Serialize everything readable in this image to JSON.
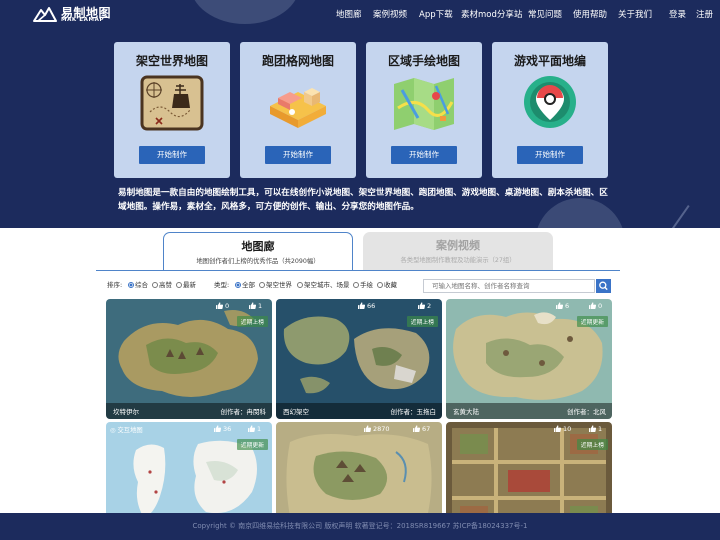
{
  "brand": {
    "name_cn": "易制地图",
    "name_en": "MAK EAMAP"
  },
  "nav": {
    "items": [
      "地图廊",
      "案例视频",
      "App下载",
      "素材mod分享站",
      "常见问题",
      "使用帮助",
      "关于我们"
    ],
    "login": "登录",
    "register": "注册"
  },
  "cards": [
    {
      "title": "架空世界地图",
      "button": "开始制作",
      "icon": "treasure-map-icon"
    },
    {
      "title": "跑团格网地图",
      "button": "开始制作",
      "icon": "isometric-grid-icon"
    },
    {
      "title": "区域手绘地图",
      "button": "开始制作",
      "icon": "folded-map-icon"
    },
    {
      "title": "游戏平面地编",
      "button": "开始制作",
      "icon": "map-pin-icon"
    }
  ],
  "intro": "易制地图是一款自由的地图绘制工具，可以在线创作小说地图、架空世界地图、跑团地图、游戏地图、桌游地图、剧本杀地图、区域地图。操作易，素材全，风格多，可方便的创作、输出、分享您的地图作品。",
  "tabs": [
    {
      "title": "地图廊",
      "subtitle": "地图创作者们上榜的优秀作品（共2090幅）"
    },
    {
      "title": "案例视频",
      "subtitle": "各类型地图制作教程及功能演示（27组）"
    }
  ],
  "filters": {
    "sort_label": "排序:",
    "sort_options": [
      "综合",
      "高赞",
      "最新"
    ],
    "sort_selected": "综合",
    "type_label": "类型:",
    "type_options": [
      "全部",
      "架空世界",
      "架空城市、场景",
      "手绘",
      "收藏"
    ],
    "type_selected": "全部",
    "search_placeholder": "可输入地图名称、创作者名称查询"
  },
  "gallery": [
    {
      "likes": "0",
      "shares": "1",
      "name": "坎特伊尔",
      "author": "创作者：冉閔科",
      "badge": "近期上榜",
      "type": ""
    },
    {
      "likes": "66",
      "shares": "2",
      "name": "西幻架空",
      "author": "创作者：玉拖白",
      "badge": "近期上榜",
      "type": ""
    },
    {
      "likes": "6",
      "shares": "0",
      "name": "玄黄大陆",
      "author": "创作者：北风",
      "badge": "近期更新",
      "type": ""
    },
    {
      "likes": "36",
      "shares": "1",
      "name": "",
      "author": "",
      "badge": "近期更新",
      "type": "交互地图"
    },
    {
      "likes": "2870",
      "shares": "67",
      "name": "",
      "author": "",
      "badge": "",
      "type": ""
    },
    {
      "likes": "10",
      "shares": "1",
      "name": "",
      "author": "",
      "badge": "近期上榜",
      "type": ""
    }
  ],
  "footer": "Copyright © 南京四维易绘科技有限公司   版权声明   软著登记号：2018SR819667  苏ICP备18024337号-1",
  "colors": {
    "header_bg": "#1c2b5d",
    "card_bg": "#c5d5ee",
    "button_blue": "#2a64b8",
    "accent_blue": "#3a73c7"
  }
}
